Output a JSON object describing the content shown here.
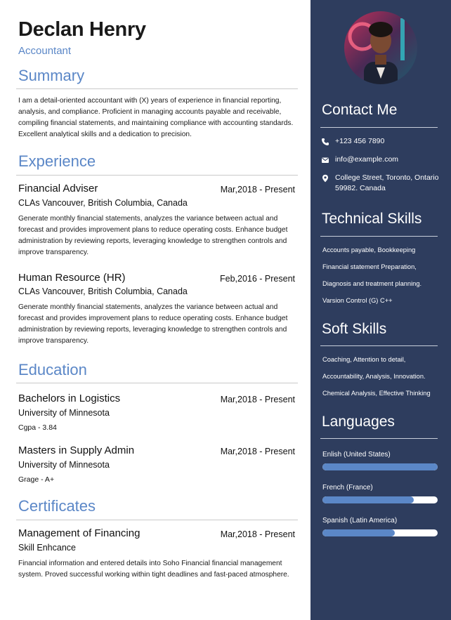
{
  "header": {
    "name": "Declan Henry",
    "role": "Accountant"
  },
  "summary": {
    "title": "Summary",
    "text": "I am a detail-oriented accountant with (X) years of experience in financial reporting, analysis, and compliance. Proficient in managing accounts payable and receivable, compiling financial statements, and maintaining compliance with accounting standards. Excellent analytical skills and a dedication to precision."
  },
  "experience": {
    "title": "Experience",
    "items": [
      {
        "title": "Financial Adviser",
        "date": "Mar,2018 - Present",
        "sub": "CLAs Vancouver, British Columbia, Canada",
        "desc": "Generate monthly financial statements, analyzes the variance between actual and forecast and provides improvement plans to reduce operating costs. Enhance budget administration by reviewing reports, leveraging knowledge to strengthen controls and improve transparency."
      },
      {
        "title": "Human Resource (HR)",
        "date": "Feb,2016 - Present",
        "sub": "CLAs Vancouver, British Columbia, Canada",
        "desc": "Generate monthly financial statements, analyzes the variance between actual and forecast and provides improvement plans to reduce operating costs. Enhance budget administration by reviewing reports, leveraging knowledge to strengthen controls and improve transparency."
      }
    ]
  },
  "education": {
    "title": "Education",
    "items": [
      {
        "title": "Bachelors in Logistics",
        "date": "Mar,2018 - Present",
        "sub": "University of Minnesota",
        "note": "Cgpa - 3.84"
      },
      {
        "title": "Masters in Supply Admin",
        "date": "Mar,2018 - Present",
        "sub": "University of Minnesota",
        "note": "Grage - A+"
      }
    ]
  },
  "certificates": {
    "title": "Certificates",
    "items": [
      {
        "title": "Management of Financing",
        "date": "Mar,2018 - Present",
        "sub": "Skill Enhcance",
        "desc": "Financial information and entered details into Soho Financial financial management system. Proved successful working within tight deadlines and fast-paced atmosphere."
      }
    ]
  },
  "sidebar": {
    "contact": {
      "title": "Contact Me",
      "phone": "+123 456 7890",
      "email": "info@example.com",
      "address": "College Street, Toronto, Ontario 59982. Canada"
    },
    "technical": {
      "title": "Technical Skills",
      "items": [
        "Accounts payable, Bookkeeping",
        "Financial statement Preparation,",
        "Diagnosis and treatment planning.",
        "Varsion Control (G) C++"
      ]
    },
    "soft": {
      "title": "Soft Skills",
      "items": [
        "Coaching, Attention to detail,",
        "Accountability, Analysis, Innovation.",
        "Chemical Analysis, Effective Thinking"
      ]
    },
    "languages": {
      "title": "Languages",
      "items": [
        {
          "name": "Enlish (United States)",
          "level": 1.0
        },
        {
          "name": "French (France)",
          "level": 0.79
        },
        {
          "name": "Spanish (Latin America)",
          "level": 0.63
        }
      ]
    }
  },
  "colors": {
    "accent": "#5b87c7",
    "sidebar": "#2e3d5e"
  }
}
